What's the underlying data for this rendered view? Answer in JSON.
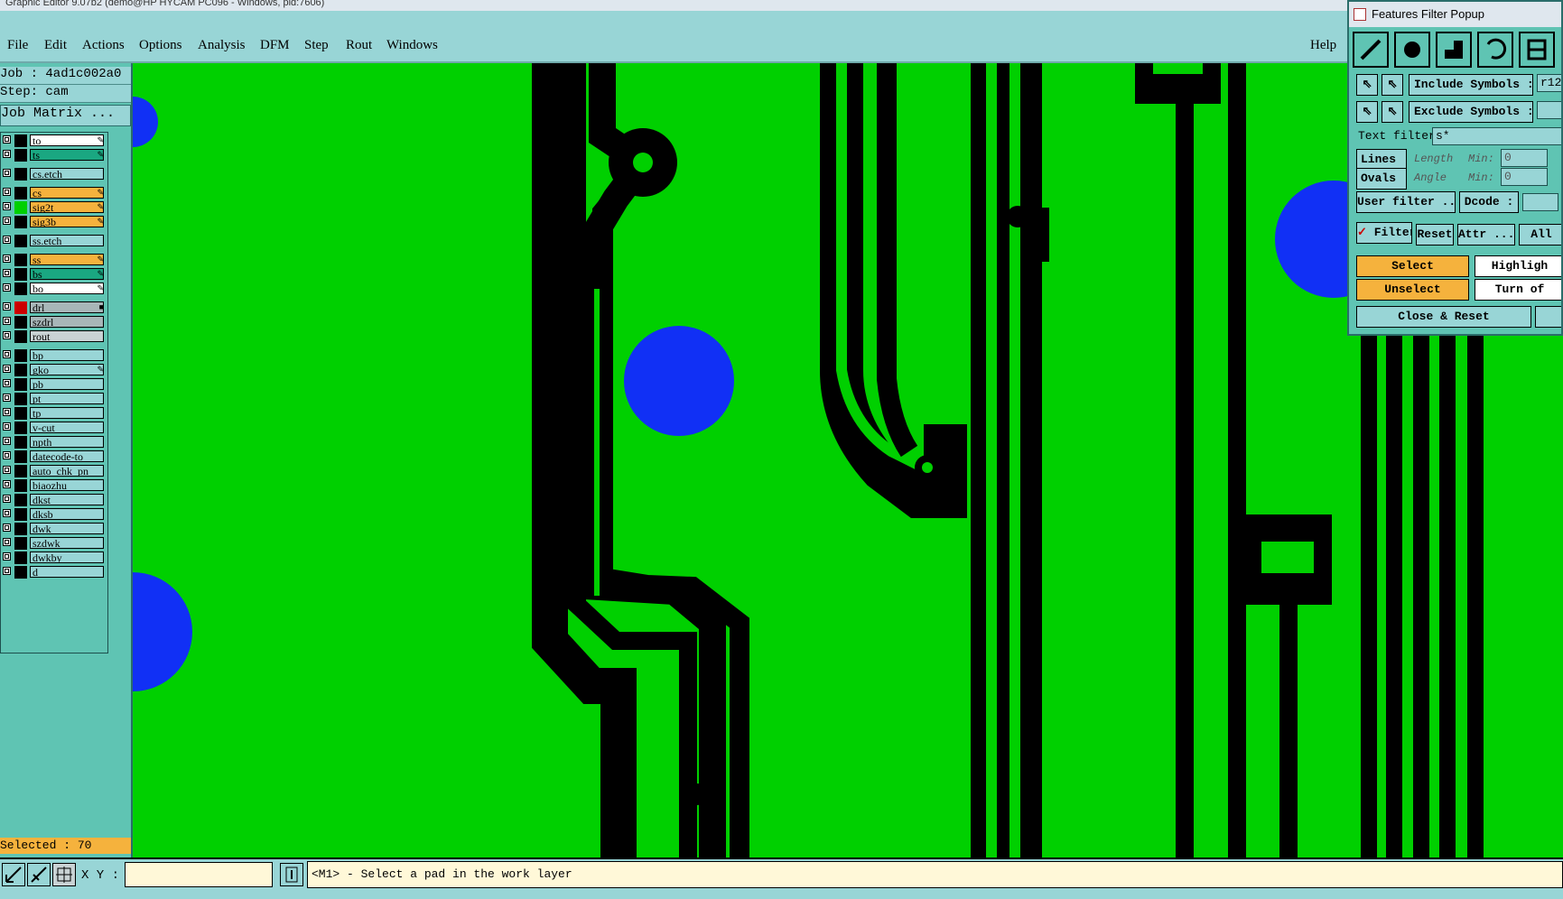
{
  "window": {
    "title": "Graphic Editor 9.07b2 (demo@HP HYCAM PC096 - Windows, pid:7606)"
  },
  "menu": {
    "items": [
      {
        "label": "File"
      },
      {
        "label": "Edit"
      },
      {
        "label": "Actions"
      },
      {
        "label": "Options"
      },
      {
        "label": "Analysis"
      },
      {
        "label": "DFM"
      },
      {
        "label": "Step"
      },
      {
        "label": "Rout"
      },
      {
        "label": "Windows"
      }
    ],
    "help": "Help"
  },
  "left": {
    "job": "Job : 4ad1c002a0",
    "step": "Step: cam",
    "job_matrix": "Job Matrix ...",
    "selected": "Selected : 70"
  },
  "layers": [
    {
      "name": "to",
      "bg": "#ffffff",
      "flag": "✎"
    },
    {
      "name": "ts",
      "bg": "#1aa781",
      "flag": "✎"
    },
    {
      "name": "cs.etch",
      "bg": "#98d5d6",
      "flag": ""
    },
    {
      "name": "cs",
      "bg": "#f5b23d",
      "flag": "✎"
    },
    {
      "name": "sig2t",
      "bg": "#f5b23d",
      "flag": "✎"
    },
    {
      "name": "sig3b",
      "bg": "#f5b23d",
      "flag": "✎"
    },
    {
      "name": "ss.etch",
      "bg": "#98d5d6",
      "flag": ""
    },
    {
      "name": "ss",
      "bg": "#f5b23d",
      "flag": "✎"
    },
    {
      "name": "bs",
      "bg": "#1aa781",
      "flag": "✎"
    },
    {
      "name": "bo",
      "bg": "#ffffff",
      "flag": "✎"
    },
    {
      "name": "drl",
      "bg": "#a8b6b8",
      "flag": "■"
    },
    {
      "name": "szdrl",
      "bg": "#a8b6b8",
      "flag": ""
    },
    {
      "name": "rout",
      "bg": "#c9d2d4",
      "flag": ""
    },
    {
      "name": "bp",
      "bg": "#98d5d6",
      "flag": ""
    },
    {
      "name": "gko",
      "bg": "#98d5d6",
      "flag": "✎"
    },
    {
      "name": "pb",
      "bg": "#98d5d6",
      "flag": ""
    },
    {
      "name": "pt",
      "bg": "#98d5d6",
      "flag": ""
    },
    {
      "name": "tp",
      "bg": "#98d5d6",
      "flag": ""
    },
    {
      "name": "v-cut",
      "bg": "#98d5d6",
      "flag": ""
    },
    {
      "name": "npth",
      "bg": "#98d5d6",
      "flag": ""
    },
    {
      "name": "datecode-to",
      "bg": "#98d5d6",
      "flag": ""
    },
    {
      "name": "auto_chk_pn",
      "bg": "#98d5d6",
      "flag": ""
    },
    {
      "name": "biaozhu",
      "bg": "#98d5d6",
      "flag": ""
    },
    {
      "name": "dkst",
      "bg": "#98d5d6",
      "flag": ""
    },
    {
      "name": "dksb",
      "bg": "#98d5d6",
      "flag": ""
    },
    {
      "name": "dwk",
      "bg": "#98d5d6",
      "flag": ""
    },
    {
      "name": "szdwk",
      "bg": "#98d5d6",
      "flag": ""
    },
    {
      "name": "dwkby",
      "bg": "#98d5d6",
      "flag": ""
    },
    {
      "name": "d",
      "bg": "#98d5d6",
      "flag": ""
    }
  ],
  "bottom": {
    "xy_label": "X Y :",
    "xy_value": "",
    "status": "<M1> - Select a pad in the work layer"
  },
  "popup": {
    "title": "Features Filter Popup",
    "include_symbols": "Include Symbols :",
    "include_value": "r12",
    "exclude_symbols": "Exclude Symbols :",
    "exclude_value": "",
    "text_filter": "Text filter",
    "text_filter_value": "s*",
    "lines": "Lines",
    "ovals": "Ovals",
    "length": "Length",
    "angle": "Angle",
    "min": "Min:",
    "min_value1": "0",
    "min_value2": "0",
    "user_filter": "User filter ...",
    "dcode": "Dcode :",
    "filter": "Filter",
    "reset": "Reset",
    "attr": "Attr ...",
    "all": "All",
    "select": "Select",
    "highlight": "Highligh",
    "unselect": "Unselect",
    "turn_off": "Turn of",
    "close_reset": "Close & Reset"
  },
  "colors": {
    "board": "#00d000",
    "copper": "#000000",
    "pad": "#1130f5",
    "panel": "#98d5d6",
    "highlight": "#f5b23d"
  }
}
